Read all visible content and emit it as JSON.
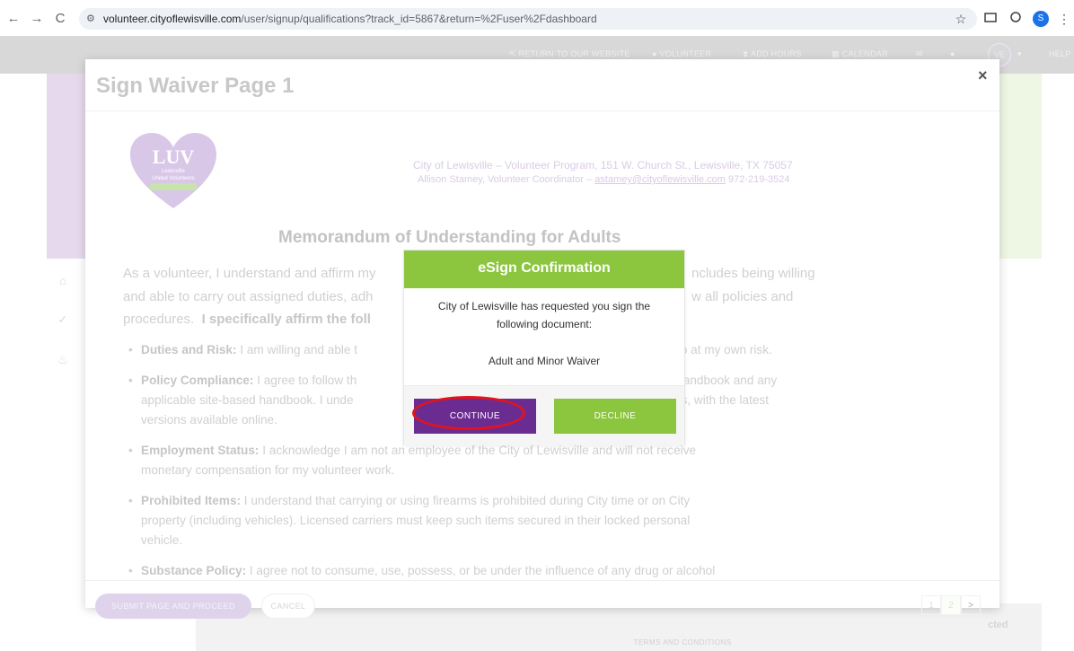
{
  "browser": {
    "url_domain": "volunteer.cityoflewisville.com",
    "url_rest": "/user/signup/qualifications?track_id=5867&return=%2Fuser%2Fdashboard",
    "back": "←",
    "forward": "→",
    "reload": "C",
    "site_info": "⚙",
    "star": "☆",
    "profile_initial": "S",
    "menu": "⋮"
  },
  "header": {
    "items": [
      "RETURN TO OUR WEBSITE",
      "VOLUNTEER",
      "ADD HOURS",
      "CALENDAR"
    ],
    "avatar": "VE",
    "help": "HELP"
  },
  "modal": {
    "title": "Sign Waiver Page 1",
    "close": "×",
    "org_line1": "City of Lewisville – Volunteer Program, 151 W. Church St., Lewisville, TX 75057",
    "org_line2_prefix": "Allison Stamey, Volunteer Coordinator – ",
    "org_email": "astamey@cityoflewisville.com",
    "org_phone": " 972-219-3524",
    "logo_text": "LUV",
    "logo_sub1": "Lewisville",
    "logo_sub2": "United Volunteers",
    "heading": "Memorandum of Understanding for Adults",
    "para_left": "As a volunteer, I understand and affirm my",
    "para_right": "ncludes being willing",
    "para2_left": "and able to carry out assigned duties, adh",
    "para2_right": "w all policies and",
    "para3_left": "procedures.",
    "para3_bold": "I specifically affirm the foll",
    "bullets": [
      {
        "bold": "Duties and Risk:",
        "left": " I am willing and able t",
        "right": "so at my own risk."
      },
      {
        "bold": "Policy Compliance:",
        "left": " I agree to follow th",
        "right": "Handbook and any"
      },
      {
        "line2_left": "applicable site-based handbook. I unde",
        "line2_right": "es, with the latest"
      },
      {
        "line3": "versions available online."
      },
      {
        "bold": "Employment Status:",
        "text": " I acknowledge I am not an employee of the City of Lewisville and will not receive",
        "line2": "monetary compensation for my volunteer work."
      },
      {
        "bold": "Prohibited Items:",
        "text": " I understand that carrying or using firearms is prohibited during City time or on City",
        "line2": "property (including vehicles). Licensed carriers must keep such items secured in their locked personal",
        "line3": "vehicle."
      },
      {
        "bold": "Substance Policy:",
        "text": " I agree not to consume, use, possess, or be under the influence of any drug or alcohol"
      }
    ],
    "submit": "SUBMIT PAGE AND PROCEED",
    "cancel": "CANCEL",
    "pages": [
      "1",
      "2",
      ">"
    ]
  },
  "esign": {
    "title": "eSign Confirmation",
    "message": "City of Lewisville has requested you sign the following document:",
    "document": "Adult and Minor Waiver",
    "continue": "CONTINUE",
    "decline": "DECLINE"
  },
  "footer": {
    "terms": "TERMS AND CONDITIONS",
    "brand": "cted"
  },
  "colors": {
    "accent_green": "#8cc63f",
    "accent_purple": "#6b2c91",
    "highlight_ring": "#e2131c"
  }
}
